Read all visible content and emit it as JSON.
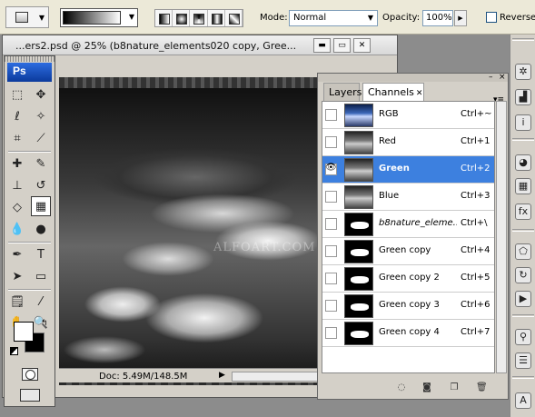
{
  "options_bar": {
    "mode_label": "Mode:",
    "mode_value": "Normal",
    "opacity_label": "Opacity:",
    "opacity_value": "100%",
    "reverse_label": "Reverse"
  },
  "document": {
    "title": "...ers2.psd @ 25% (b8nature_elements020 copy, Gree...",
    "watermark": "ALFOART.COM",
    "status_doc": "Doc: 5.49M/148.5M"
  },
  "toolbox": {
    "logo": "Ps"
  },
  "channels_panel": {
    "tabs": [
      {
        "label": "Layers"
      },
      {
        "label": "Channels"
      }
    ],
    "rows": [
      {
        "name": "RGB",
        "shortcut": "Ctrl+~",
        "visible": false,
        "selected": false
      },
      {
        "name": "Red",
        "shortcut": "Ctrl+1",
        "visible": false,
        "selected": false
      },
      {
        "name": "Green",
        "shortcut": "Ctrl+2",
        "visible": true,
        "selected": true
      },
      {
        "name": "Blue",
        "shortcut": "Ctrl+3",
        "visible": false,
        "selected": false
      },
      {
        "name": "b8nature_eleme...",
        "shortcut": "Ctrl+\\",
        "visible": false,
        "selected": false
      },
      {
        "name": "Green copy",
        "shortcut": "Ctrl+4",
        "visible": false,
        "selected": false
      },
      {
        "name": "Green copy 2",
        "shortcut": "Ctrl+5",
        "visible": false,
        "selected": false
      },
      {
        "name": "Green copy 3",
        "shortcut": "Ctrl+6",
        "visible": false,
        "selected": false
      },
      {
        "name": "Green copy 4",
        "shortcut": "Ctrl+7",
        "visible": false,
        "selected": false
      }
    ]
  },
  "colors": {
    "selection": "#3d80df",
    "chrome": "#d4d0c8"
  }
}
